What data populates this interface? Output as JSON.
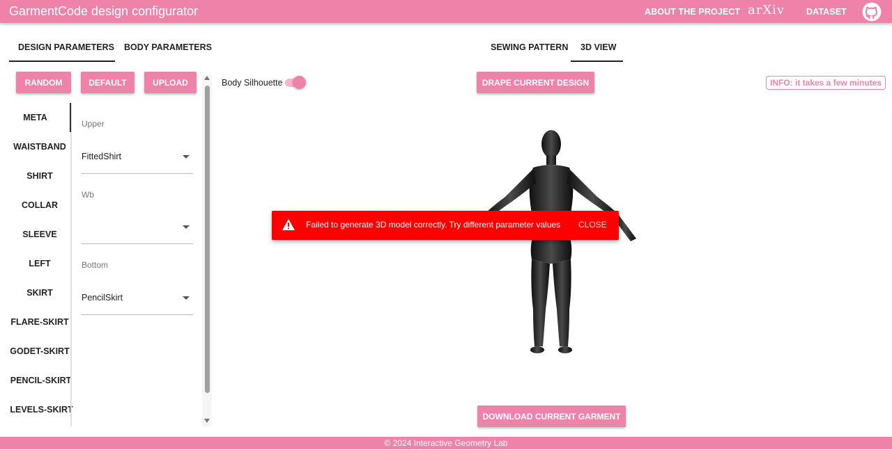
{
  "app": {
    "title": "GarmentCode design configurator"
  },
  "nav": {
    "about": "ABOUT THE PROJECT",
    "arxiv": "arXiv",
    "dataset": "DATASET"
  },
  "left_tabs": [
    "DESIGN PARAMETERS",
    "BODY PARAMETERS"
  ],
  "right_tabs": [
    "SEWING PATTERN",
    "3D VIEW"
  ],
  "buttons": {
    "random": "RANDOM",
    "default": "DEFAULT",
    "upload": "UPLOAD",
    "drape": "DRAPE CURRENT DESIGN",
    "download": "DOWNLOAD CURRENT GARMENT"
  },
  "sidebar": [
    "META",
    "WAISTBAND",
    "SHIRT",
    "COLLAR",
    "SLEEVE",
    "LEFT",
    "SKIRT",
    "FLARE-SKIRT",
    "GODET-SKIRT",
    "PENCIL-SKIRT",
    "LEVELS-SKIRT"
  ],
  "fields": {
    "upper": {
      "label": "Upper",
      "value": "FittedShirt"
    },
    "wb": {
      "label": "Wb",
      "value": ""
    },
    "bottom": {
      "label": "Bottom",
      "value": "PencilSkirt"
    }
  },
  "toggle": {
    "label": "Body Silhouette",
    "on": true
  },
  "info": "INFO: it takes a few minutes",
  "snackbar": {
    "message": "Failed to generate 3D model correctly. Try different parameter values",
    "close": "CLOSE"
  },
  "footer": "© 2024 Interactive Geometry Lab",
  "colors": {
    "accent": "#ee82a8",
    "error": "#ff0000"
  },
  "icons": {
    "github": "github-icon",
    "warning": "warning-icon"
  }
}
